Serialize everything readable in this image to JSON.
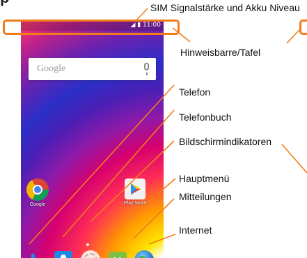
{
  "labels": {
    "sim_battery": "SIM Signalstärke und Akku Niveau",
    "notification_bar": "Hinweisbarre/Tafel",
    "phone": "Telefon",
    "phonebook": "Telefonbuch",
    "screen_indicators": "Bildschirmindikatoren",
    "main_menu": "Hauptmenü",
    "messages": "Mitteilungen",
    "internet": "Internet"
  },
  "phone": {
    "status_time": "11:00",
    "search_placeholder": "Google",
    "apps": [
      {
        "label": "Google",
        "icon": "chrome-icon"
      },
      {
        "label": "Play Store",
        "icon": "play-store-icon"
      }
    ],
    "dock": [
      "phone-icon",
      "contacts-icon",
      "app-drawer-icon",
      "messaging-icon",
      "browser-icon"
    ]
  },
  "colors": {
    "accent": "#f07d1a"
  }
}
